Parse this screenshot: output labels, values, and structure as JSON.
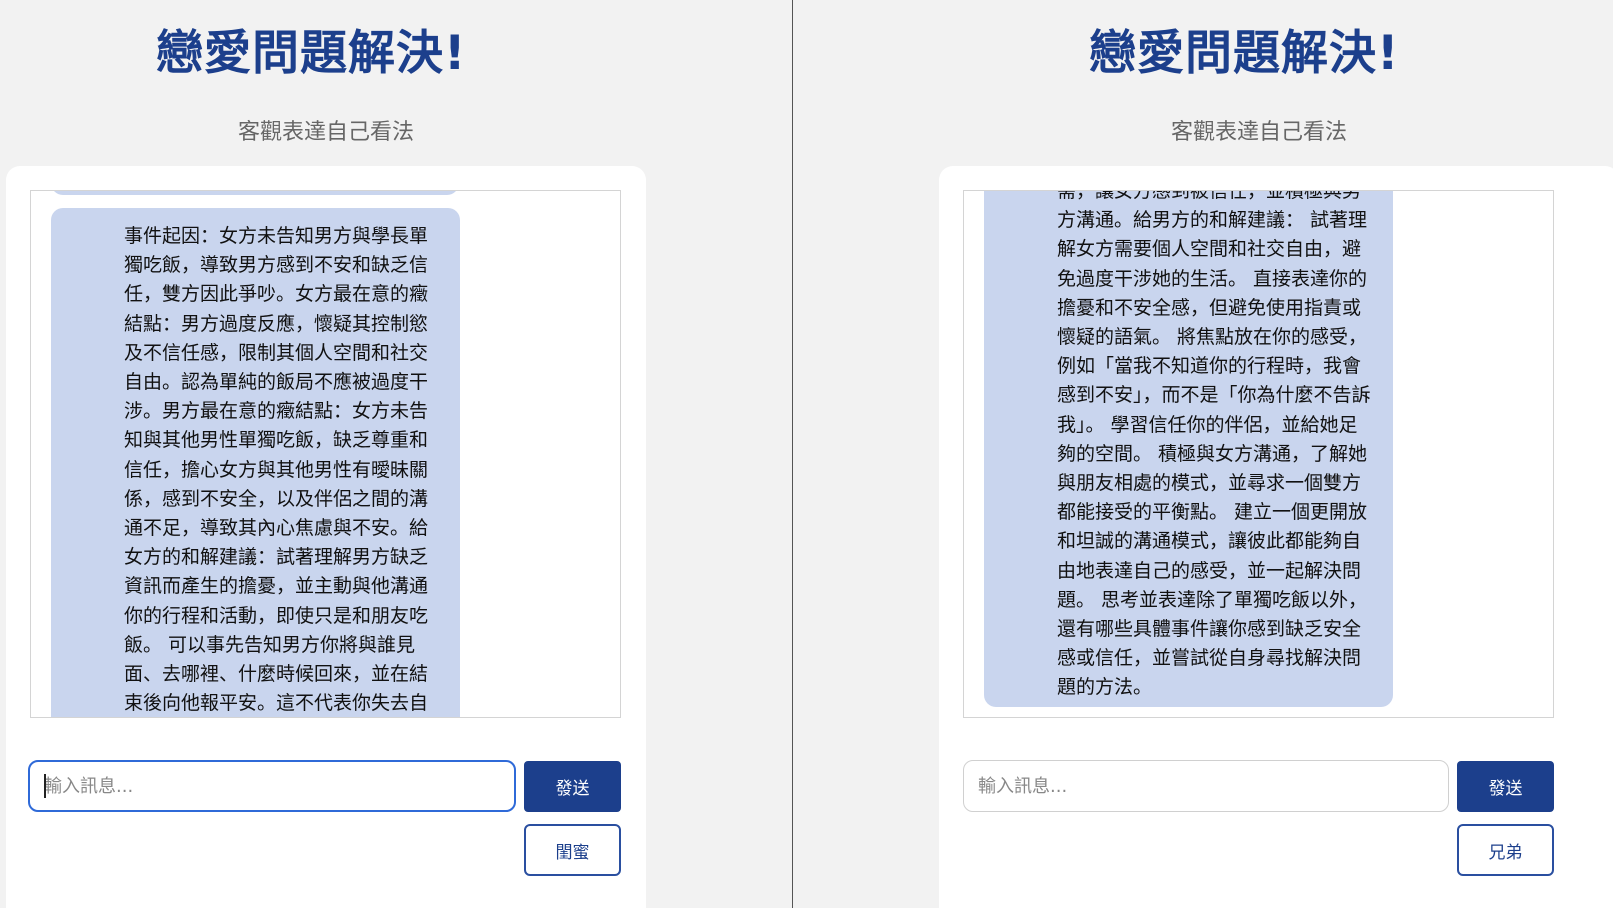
{
  "left_panel": {
    "title": "戀愛問題解決!",
    "subtitle": "客觀表達自己看法",
    "chat": {
      "message": "事件起因：女方未告知男方與學長單獨吃飯，導致男方感到不安和缺乏信任，雙方因此爭吵。女方最在意的癥結點：男方過度反應，懷疑其控制慾及不信任感，限制其個人空間和社交自由。認為單純的飯局不應被過度干涉。男方最在意的癥結點：女方未告知與其他男性單獨吃飯，缺乏尊重和信任，擔心女方與其他男性有曖昧關係，感到不安全，以及伴侶之間的溝通不足，導致其內心焦慮與不安。給女方的和解建議：試著理解男方缺乏資訊而產生的擔憂，並主動與他溝通你的行程和活動，即使只是和朋友吃飯。 可以事先告知男方你將與誰見面、去哪裡、什麼時候回來，並在結束後向他報平安。這不代表你失去自"
    },
    "input": {
      "placeholder": "輸入訊息...",
      "value": ""
    },
    "send_label": "發送",
    "role_label": "閨蜜"
  },
  "right_panel": {
    "title": "戀愛問題解決!",
    "subtitle": "客觀表達自己看法",
    "chat": {
      "message": "需，讓女方感到被信任，並積極與男方溝通。給男方的和解建議： 試著理解女方需要個人空間和社交自由，避免過度干涉她的生活。 直接表達你的擔憂和不安全感，但避免使用指責或懷疑的語氣。 將焦點放在你的感受，例如「當我不知道你的行程時，我會感到不安」，而不是「你為什麼不告訴我」。 學習信任你的伴侶，並給她足夠的空間。 積極與女方溝通，了解她與朋友相處的模式，並尋求一個雙方都能接受的平衡點。 建立一個更開放和坦誠的溝通模式，讓彼此都能夠自由地表達自己的感受，並一起解決問題。 思考並表達除了單獨吃飯以外，還有哪些具體事件讓你感到缺乏安全感或信任，並嘗試從自身尋找解決問題的方法。"
    },
    "input": {
      "placeholder": "輸入訊息...",
      "value": ""
    },
    "send_label": "發送",
    "role_label": "兄弟"
  },
  "colors": {
    "page_background": "#f2f2f2",
    "title": "#1c3f8c",
    "bubble": "#c9d5ee",
    "send_button": "#1c3f8c",
    "input_focus_border": "#2f6ad8"
  }
}
